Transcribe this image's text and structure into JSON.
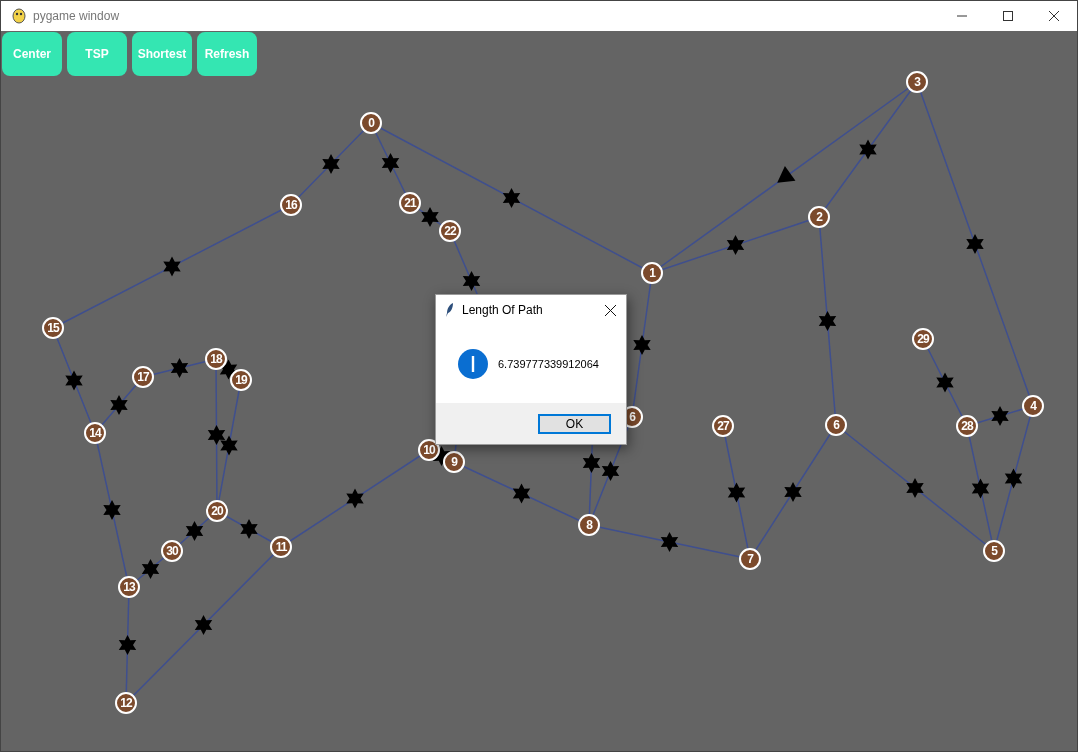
{
  "window": {
    "title": "pygame window"
  },
  "toolbar": [
    {
      "label": "Center"
    },
    {
      "label": "TSP"
    },
    {
      "label": "Shortest"
    },
    {
      "label": "Refresh"
    }
  ],
  "graph": {
    "nodes": [
      {
        "label": "0"
      },
      {
        "label": "1"
      },
      {
        "label": "2"
      },
      {
        "label": "3"
      },
      {
        "label": "4"
      },
      {
        "label": "5"
      },
      {
        "label": "6"
      },
      {
        "label": "7"
      },
      {
        "label": "8"
      },
      {
        "label": "10"
      },
      {
        "label": "9"
      },
      {
        "label": "11"
      },
      {
        "label": "12"
      },
      {
        "label": "13"
      },
      {
        "label": "14"
      },
      {
        "label": "15"
      },
      {
        "label": "16"
      },
      {
        "label": "17"
      },
      {
        "label": "18"
      },
      {
        "label": "19"
      },
      {
        "label": "20"
      },
      {
        "label": "21"
      },
      {
        "label": "22"
      },
      {
        "label": "6"
      },
      {
        "label": "27"
      },
      {
        "label": "28"
      },
      {
        "label": "29"
      },
      {
        "label": "30"
      }
    ],
    "edges": [
      {
        "kind": "star"
      },
      {
        "kind": "star"
      },
      {
        "kind": "star"
      },
      {
        "kind": "star"
      },
      {
        "kind": "star"
      },
      {
        "kind": "star"
      },
      {
        "kind": "triangle"
      },
      {
        "kind": "star"
      },
      {
        "kind": "star"
      },
      {
        "kind": "star"
      },
      {
        "kind": "star"
      },
      {
        "kind": "star"
      },
      {
        "kind": "star"
      },
      {
        "kind": "star"
      },
      {
        "kind": "plain"
      },
      {
        "kind": "star"
      },
      {
        "kind": "star"
      },
      {
        "kind": "star"
      },
      {
        "kind": "star"
      },
      {
        "kind": "star"
      },
      {
        "kind": "lone-star"
      },
      {
        "kind": "star"
      },
      {
        "kind": "star"
      },
      {
        "kind": "star"
      },
      {
        "kind": "star"
      },
      {
        "kind": "star"
      },
      {
        "kind": "star"
      },
      {
        "kind": "star"
      },
      {
        "kind": "star"
      },
      {
        "kind": "star"
      },
      {
        "kind": "star"
      },
      {
        "kind": "lone-star"
      },
      {
        "kind": "star"
      },
      {
        "kind": "star"
      },
      {
        "kind": "star"
      },
      {
        "kind": "star"
      },
      {
        "kind": "star"
      },
      {
        "kind": "star"
      }
    ]
  },
  "dialog": {
    "title": "Length Of Path",
    "message": "6.739777339912064",
    "button": "OK"
  }
}
